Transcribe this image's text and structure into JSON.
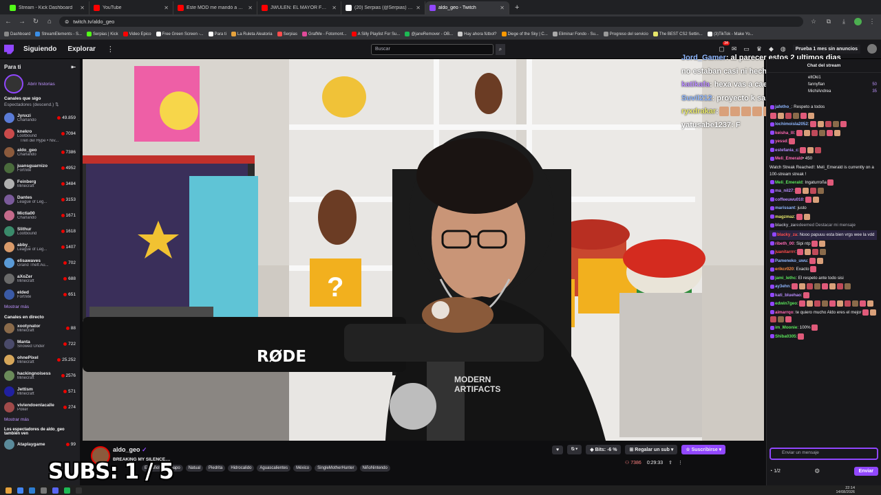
{
  "browser": {
    "tabs": [
      {
        "title": "Stream - Kick Dashboard",
        "color": "#53fc18",
        "active": false
      },
      {
        "title": "YouTube",
        "color": "#ff0000",
        "active": false
      },
      {
        "title": "Este MOD me mandó a TERAPI...",
        "color": "#ff0000",
        "active": false
      },
      {
        "title": "JWULEN: EL MAYOR FRAUDE D...",
        "color": "#ff0000",
        "active": false
      },
      {
        "title": "(20) Serpias (@Serpias) / X",
        "color": "#ffffff",
        "active": false
      },
      {
        "title": "aldo_geo - Twitch",
        "color": "#9147ff",
        "active": true
      }
    ],
    "url": "twitch.tv/aldo_geo",
    "bookmarks": [
      "Dashboard",
      "StreamElements - S...",
      "Serpias | Kick",
      "Video Epico",
      "Free Green Screen -...",
      "Para ti",
      "La Ruleta Aleatoria",
      "Serpias",
      "GrafMe - Fotomont...",
      "A Silly Playlist For Su...",
      "@janeRemover - OB...",
      "Hay ahora fútbol?",
      "Diege of the Sky | C...",
      "Eliminar Fondo - Su...",
      "Progreso del servicio",
      "The BEST CS2 Settin...",
      "(3)TikTok - Make Yo..."
    ]
  },
  "nav": {
    "following": "Siguiendo",
    "browse": "Explorar",
    "search_placeholder": "Buscar",
    "notif_count": "34",
    "prime": "Prueba 1 mes sin anuncios"
  },
  "sidebar": {
    "header": "Para ti",
    "stories": "Abrir historias",
    "followed_title": "Canales que sigo",
    "sort_label": "Espectadores (descend.)",
    "followed": [
      {
        "name": "Jynxzi",
        "game": "Charlando",
        "viewers": "49.859",
        "color": "#5a7bd6"
      },
      {
        "name": "knekro",
        "game": "Lootbound",
        "viewers": "7094",
        "color": "#c94a4a"
      },
      {
        "name": "",
        "game": "Tren del Hype • Niv...",
        "viewers": "",
        "color": "transparent"
      },
      {
        "name": "aldo_geo",
        "game": "Charlando",
        "viewers": "7386",
        "color": "#8b5a3c"
      },
      {
        "name": "juansguarnizo",
        "game": "Fortnite",
        "viewers": "4952",
        "color": "#4a6b3c"
      },
      {
        "name": "Feinberg",
        "game": "Minecraft",
        "viewers": "3484",
        "color": "#b0b0b0"
      },
      {
        "name": "Dantes",
        "game": "League of Leg...",
        "viewers": "3153",
        "color": "#7a5a9a"
      },
      {
        "name": "Mictia00",
        "game": "Charlando",
        "viewers": "1671",
        "color": "#c46a8a"
      },
      {
        "name": "Slithur",
        "game": "Lootbound",
        "viewers": "1618",
        "color": "#3a8a6a"
      },
      {
        "name": "abby_",
        "game": "League of Leg...",
        "viewers": "1407",
        "color": "#d99a6a"
      },
      {
        "name": "elisawaves",
        "game": "Grand Theft Au...",
        "viewers": "702",
        "color": "#5a9ad6"
      },
      {
        "name": "aXoZer",
        "game": "Minecraft",
        "viewers": "688",
        "color": "#6a6a6a"
      },
      {
        "name": "elded",
        "game": "Fortnite",
        "viewers": "651",
        "color": "#3a5aa6"
      }
    ],
    "more1": "Mostrar más",
    "live_title": "Canales en directo",
    "live": [
      {
        "name": "xootynator",
        "game": "Minecraft",
        "viewers": "88",
        "color": "#8a6a4a"
      },
      {
        "name": "Manta",
        "game": "Snowed Under",
        "viewers": "722",
        "color": "#4a4a6a"
      },
      {
        "name": "ohnePixel",
        "game": "Minecraft",
        "viewers": "25.252",
        "color": "#d6a65a"
      },
      {
        "name": "hackingnoisess",
        "game": "Minecraft",
        "viewers": "2576",
        "color": "#6a8a5a"
      },
      {
        "name": "Jettism",
        "game": "Minecraft",
        "viewers": "571",
        "color": "#2020a0"
      },
      {
        "name": "viviendoenlacalle",
        "game": "Poker",
        "viewers": "274",
        "color": "#a04a4a"
      }
    ],
    "more2": "Mostrar más",
    "also_title": "Los espectadores de aldo_geo también ven",
    "also": [
      {
        "name": "Ataplaygame",
        "game": "",
        "viewers": "99",
        "color": "#5a8a9a"
      }
    ]
  },
  "overlay_chat": [
    {
      "user": "Jord_Gamer",
      "color": "#8fb7ff",
      "text": ": al parecer estos 2 ultimos dias no estaban casi ni hechos?"
    },
    {
      "user": "katikafa",
      "color": "#b98cff",
      "text": ": hexa vas a caer"
    },
    {
      "user": "Suvil212",
      "color": "#8fb7ff",
      "text": ": proyecto k sale en el 2060 chavales"
    },
    {
      "user": "ryxdrakar",
      "color": "#e6e66a",
      "text": ":"
    },
    {
      "user": "yatusabe1237",
      "color": "#ffffff",
      "text": ": F"
    }
  ],
  "subs_overlay": "SUBS: 1 / 5",
  "stream": {
    "name": "aldo_geo",
    "title": "BREAKING MY SILENCE....",
    "tags": [
      "Español",
      "Guapo",
      "Natual",
      "Piedrita",
      "Hidrocalido",
      "Aguascalientes",
      "México",
      "SingleMotherHunter",
      "NiñoNintendo"
    ],
    "bits": "Bits: -6 %",
    "gift": "Regalar un sub",
    "subscribe": "Suscribirse",
    "viewers": "7386",
    "uptime": "0:29:33",
    "mic_brand": "RØDE"
  },
  "chat": {
    "header": "Chat del stream",
    "top": [
      {
        "user": "eltOki1",
        "amount": ""
      },
      {
        "user": "fannyflan",
        "amount": "50"
      },
      {
        "user": "MichiAndrea",
        "amount": "35"
      }
    ],
    "messages": [
      {
        "user": "jafetho_",
        "color": "#8fb7ff",
        "text": ": Respeto a todos",
        "emotes": 0
      },
      {
        "user": "",
        "color": "#efeff1",
        "text": "",
        "emotes": 6
      },
      {
        "user": "lochimoisla2052",
        "color": "#8fb7ff",
        "text": ":",
        "emotes": 5
      },
      {
        "user": "keisha_lll",
        "color": "#ff69b4",
        "text": ":",
        "emotes": 6
      },
      {
        "user": "yessd",
        "color": "#ff69b4",
        "text": ":",
        "emotes": 1
      },
      {
        "user": "estefania_c",
        "color": "#b98cff",
        "text": ":",
        "emotes": 3
      },
      {
        "user": "Meli_Emerald",
        "color": "#ff69b4",
        "text": "• 450",
        "emotes": 0
      },
      {
        "user": "",
        "color": "#efeff1",
        "text": "Watch Streak Reached!: Meli_Emerald is currently on a 100-stream streak !",
        "emotes": 0
      },
      {
        "user": "Meli_Emerald",
        "color": "#5ce65c",
        "text": ": Ingaturroña",
        "emotes": 1
      },
      {
        "user": "ma_nil27",
        "color": "#b98cff",
        "text": ":",
        "emotes": 4
      },
      {
        "user": "coffeeuwu010",
        "color": "#b98cff",
        "text": ":",
        "emotes": 2
      },
      {
        "user": "marissant",
        "color": "#8fb7ff",
        "text": ": justo",
        "emotes": 0
      },
      {
        "user": "magzmaz",
        "color": "#e6e66a",
        "text": ":",
        "emotes": 2
      },
      {
        "user": "blacky_za",
        "color": "#adadb8",
        "text": "redeemed Destacar mi mensaje",
        "emotes": 0
      },
      {
        "user": "blacky_za",
        "color": "#ff4d4d",
        "text": ": Nooo papuuu esta bien vrgs wee la vdd",
        "emotes": 0
      },
      {
        "user": "ribeth_00",
        "color": "#ff69b4",
        "text": ": Sipi ntp",
        "emotes": 2
      },
      {
        "user": "juanitarrrr",
        "color": "#ff4d4d",
        "text": ":",
        "emotes": 4
      },
      {
        "user": "Pameneko_uwu",
        "color": "#8fb7ff",
        "text": ":",
        "emotes": 2
      },
      {
        "user": "erikcr020",
        "color": "#ff8c42",
        "text": ": Exacto",
        "emotes": 1
      },
      {
        "user": "jami_lethc",
        "color": "#5ce65c",
        "text": ": El respeto ante todo sisi",
        "emotes": 0
      },
      {
        "user": "ay3ehn",
        "color": "#8fb7ff",
        "text": ":",
        "emotes": 8
      },
      {
        "user": "kati_bluehao",
        "color": "#b98cff",
        "text": ":",
        "emotes": 1
      },
      {
        "user": "edwin7geo",
        "color": "#5ce65c",
        "text": ":",
        "emotes": 10
      },
      {
        "user": "aimarrqo",
        "color": "#ff69b4",
        "text": ": te quiero mucho Aldo eres el mejor",
        "emotes": 5
      },
      {
        "user": "im_Moonie",
        "color": "#5ce65c",
        "text": ": 100%",
        "emotes": 1
      },
      {
        "user": "Shiba0305",
        "color": "#5ce65c",
        "text": ":",
        "emotes": 1
      }
    ],
    "input_placeholder": "Enviar un mensaje",
    "points": "1/2",
    "send": "Enviar"
  },
  "taskbar": {
    "time": "22:14",
    "date": "14/08/2026"
  }
}
